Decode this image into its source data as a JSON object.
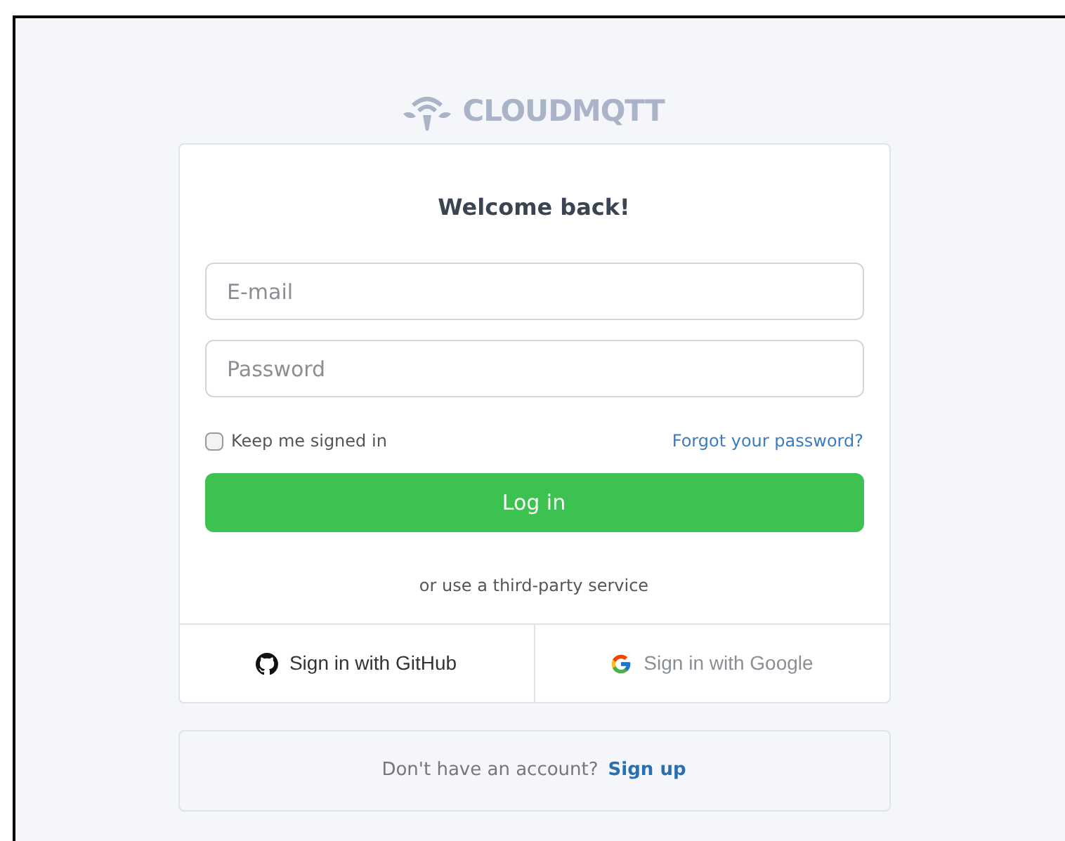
{
  "logo": {
    "text": "CLOUDMQTT"
  },
  "card": {
    "title": "Welcome back!",
    "fields": [
      {
        "placeholder": "E-mail"
      },
      {
        "placeholder": "Password"
      }
    ],
    "remember": {
      "label": "Keep me signed in",
      "checked": false
    },
    "forgot_link": "Forgot your password?",
    "login_button": "Log in",
    "third_party_label": "or use a third-party service",
    "social_buttons": [
      {
        "kind": "github",
        "label": "Sign in with GitHub"
      },
      {
        "kind": "google",
        "label": "Sign in with Google"
      }
    ]
  },
  "signup": {
    "prompt": "Don't have an account?",
    "link": "Sign up"
  }
}
